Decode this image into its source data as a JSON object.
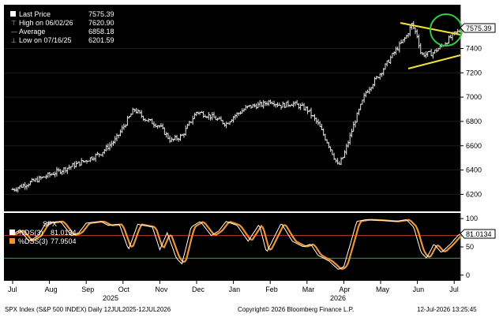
{
  "legend": {
    "rows": [
      {
        "label": "Last Price",
        "value": "7575.39",
        "marker": "box"
      },
      {
        "label": "High on 06/02/26",
        "value": "7620.90",
        "marker": "tick"
      },
      {
        "label": "Average",
        "value": "6858.18",
        "marker": "tick"
      },
      {
        "label": "Low on 07/16/25",
        "value": "6201.59",
        "marker": "tick"
      }
    ]
  },
  "osc_legend": {
    "title": "SPX",
    "rows": [
      {
        "label": "%DS(3)",
        "value": "81.0134",
        "color": "#ffffff"
      },
      {
        "label": "%DSS(3)",
        "value": "77.9504",
        "color": "#f2932c"
      }
    ]
  },
  "footer": {
    "left": "SPX Index (S&P 500 INDEX) Daily 12JUL2025-12JUL2026",
    "center": "Copyright© 2026 Bloomberg Finance L.P.",
    "right": "12-Jul-2026  13:25:45"
  },
  "colors": {
    "background": "#000000",
    "bars": "#e6e6e6",
    "ds": "#ffffff",
    "dss": "#f2932c",
    "overbought_line": "#c0392b",
    "oversold_line": "#27a844",
    "trendlines": "#f1e33b",
    "circle": "#2ecc40"
  },
  "chart_data": [
    {
      "type": "ohlc",
      "series_name": "SPX",
      "x_ticks": [
        "Jul",
        "Aug",
        "Sep",
        "Oct",
        "Nov",
        "Dec",
        "Jan",
        "Feb",
        "Mar",
        "Apr",
        "May",
        "Jun",
        "Jul"
      ],
      "year_labels": [
        "2025",
        "2026"
      ],
      "y_ticks": [
        6200,
        6400,
        6600,
        6800,
        7000,
        7200,
        7400
      ],
      "ylim": [
        6060,
        7760
      ],
      "last_value_tag": "7575.39",
      "close_anchors": [
        [
          0,
          6240
        ],
        [
          0.5,
          6300
        ],
        [
          1,
          6360
        ],
        [
          1.5,
          6420
        ],
        [
          2,
          6480
        ],
        [
          2.4,
          6540
        ],
        [
          2.8,
          6650
        ],
        [
          3.0,
          6750
        ],
        [
          3.3,
          6900
        ],
        [
          3.6,
          6820
        ],
        [
          4.0,
          6760
        ],
        [
          4.3,
          6640
        ],
        [
          4.6,
          6680
        ],
        [
          5.0,
          6880
        ],
        [
          5.4,
          6840
        ],
        [
          5.8,
          6780
        ],
        [
          6.0,
          6840
        ],
        [
          6.4,
          6920
        ],
        [
          6.8,
          6940
        ],
        [
          7.0,
          6970
        ],
        [
          7.3,
          6930
        ],
        [
          7.6,
          6950
        ],
        [
          8.0,
          6900
        ],
        [
          8.3,
          6780
        ],
        [
          8.6,
          6600
        ],
        [
          8.85,
          6430
        ],
        [
          9.0,
          6520
        ],
        [
          9.3,
          6800
        ],
        [
          9.6,
          7040
        ],
        [
          10.0,
          7200
        ],
        [
          10.4,
          7380
        ],
        [
          10.7,
          7500
        ],
        [
          10.85,
          7600
        ],
        [
          11.0,
          7500
        ],
        [
          11.1,
          7350
        ],
        [
          11.4,
          7360
        ],
        [
          11.7,
          7430
        ],
        [
          12.0,
          7520
        ],
        [
          12.35,
          7575.39
        ]
      ]
    },
    {
      "type": "line",
      "title": "SPX",
      "y_ticks": [
        0,
        50,
        100
      ],
      "ylim": [
        -10,
        110
      ],
      "reference_lines": [
        70,
        30
      ],
      "series": [
        {
          "name": "%DS(3)",
          "last": 81.0134
        },
        {
          "name": "%DSS(3)",
          "last": 77.9504
        }
      ],
      "anchors": [
        [
          0,
          72
        ],
        [
          0.2,
          80
        ],
        [
          0.45,
          60
        ],
        [
          0.7,
          70
        ],
        [
          0.9,
          92
        ],
        [
          1.3,
          95
        ],
        [
          1.6,
          70
        ],
        [
          1.8,
          75
        ],
        [
          2.0,
          92
        ],
        [
          2.4,
          95
        ],
        [
          2.6,
          88
        ],
        [
          2.9,
          90
        ],
        [
          3.15,
          45
        ],
        [
          3.4,
          90
        ],
        [
          3.8,
          85
        ],
        [
          4.0,
          45
        ],
        [
          4.2,
          75
        ],
        [
          4.45,
          30
        ],
        [
          4.6,
          20
        ],
        [
          4.85,
          85
        ],
        [
          5.1,
          95
        ],
        [
          5.4,
          70
        ],
        [
          5.6,
          78
        ],
        [
          5.8,
          95
        ],
        [
          6.1,
          88
        ],
        [
          6.4,
          60
        ],
        [
          6.7,
          90
        ],
        [
          6.9,
          40
        ],
        [
          7.3,
          92
        ],
        [
          7.6,
          60
        ],
        [
          7.9,
          50
        ],
        [
          8.1,
          55
        ],
        [
          8.3,
          35
        ],
        [
          8.6,
          25
        ],
        [
          8.85,
          10
        ],
        [
          9.0,
          15
        ],
        [
          9.2,
          60
        ],
        [
          9.35,
          95
        ],
        [
          9.6,
          98
        ],
        [
          10.0,
          97
        ],
        [
          10.4,
          95
        ],
        [
          10.7,
          98
        ],
        [
          10.9,
          85
        ],
        [
          11.1,
          40
        ],
        [
          11.25,
          30
        ],
        [
          11.45,
          55
        ],
        [
          11.65,
          40
        ],
        [
          11.9,
          55
        ],
        [
          12.1,
          70
        ],
        [
          12.35,
          81
        ]
      ]
    }
  ]
}
